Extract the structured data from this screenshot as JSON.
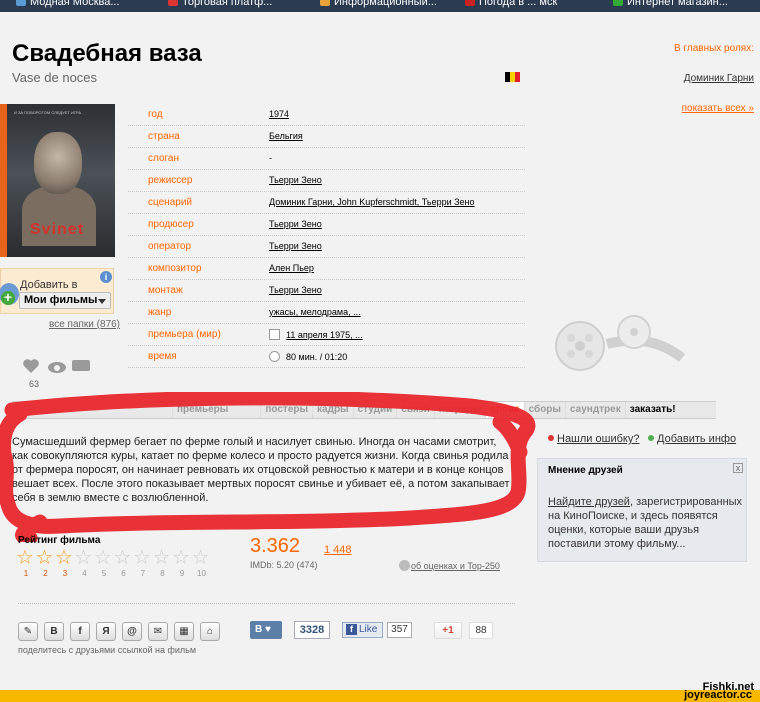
{
  "bookmarks": [
    {
      "label": "Модная Москва..."
    },
    {
      "label": "Торговая платф..."
    },
    {
      "label": "Информационный..."
    },
    {
      "label": "Погода в ... мск"
    },
    {
      "label": "Интернет магазин..."
    }
  ],
  "film": {
    "title": "Свадебная ваза",
    "original_title": "Vase de noces"
  },
  "roles": {
    "heading": "В главных ролях:",
    "actor": "Доминик Гарни",
    "show_all": "показать всех »"
  },
  "poster": {
    "title": "Svinet",
    "top_text": "И ЗА ПОВОРОТОМ СЛЕДУЕТ ИГРА"
  },
  "add_box": {
    "label": "Добавить в",
    "selected": "Мои фильмы",
    "info_icon": "i",
    "all_folders": "все папки (876)"
  },
  "stats": {
    "count": "63"
  },
  "info_rows": [
    {
      "key": "год",
      "value": "1974"
    },
    {
      "key": "страна",
      "value": "Бельгия"
    },
    {
      "key": "слоган",
      "value": "-"
    },
    {
      "key": "режиссер",
      "value": "Тьерри Зено"
    },
    {
      "key": "сценарий",
      "value": "Доминик Гарни, John Kupferschmidt, Тьерри Зено"
    },
    {
      "key": "продюсер",
      "value": "Тьерри Зено"
    },
    {
      "key": "оператор",
      "value": "Тьерри Зено"
    },
    {
      "key": "композитор",
      "value": "Ален Пьер"
    },
    {
      "key": "монтаж",
      "value": "Тьерри Зено"
    },
    {
      "key": "жанр",
      "value": "ужасы, мелодрама, ..."
    },
    {
      "key": "премьера (мир)",
      "value": "11 апреля 1975, ..."
    },
    {
      "key": "время",
      "value": "80 мин. / 01:20"
    }
  ],
  "tabs": [
    "",
    "",
    "премьеры",
    "",
    "постеры",
    "кадры",
    "студии",
    "связи",
    "награды",
    "слова",
    "сборы",
    "саундтрек",
    "заказать!"
  ],
  "tagline": "Сумасшедший фермер бегает по ферме голый и насилует свинью. Иногда он часами смотрит, как совокупляются куры, катает по ферме колесо и просто радуется жизни. Когда свинья родила от фермера поросят, он начинает ревновать их отцовской ревностью к матери и в конце концов вешает всех. После этого показывает мертвых поросят свинье и убивает её, а потом закапывает себя в землю вместе с возлюбленной.",
  "side_links": {
    "error": "Нашли ошибку?",
    "add_info": "Добавить инфо"
  },
  "friends": {
    "heading": "Мнение друзей",
    "close": "x",
    "link": "Найдите друзей",
    "text": ", зарегистрированных на КиноПоиске, и здесь появятся оценки, которые ваши друзья поставили этому фильму..."
  },
  "rating": {
    "heading": "Рейтинг фильма",
    "user_rating": 3,
    "max": 10,
    "numbers": [
      "1",
      "2",
      "3",
      "4",
      "5",
      "6",
      "7",
      "8",
      "9",
      "10"
    ],
    "score": "3.362",
    "votes": "1 448",
    "imdb": "IMDb: 5.20 (474)",
    "about": "об оценках и Top-250"
  },
  "share": {
    "buttons": [
      "✎",
      "B",
      "f",
      "Я",
      "@",
      "✉",
      "▦",
      "⌂"
    ],
    "note": "поделитесь с друзьями ссылкой на фильм",
    "vk_label": "В ♥",
    "vk_count": "3328",
    "fb_label": "Like",
    "fb_count": "357",
    "gplus_label": "+1",
    "gplus_count": "88"
  },
  "watermarks": {
    "top": "Fishki.net",
    "bottom": "joyreactor.cc"
  },
  "colors": {
    "accent": "#ff6600",
    "scribble": "#e8242a",
    "bottom_bar": "#f8b800"
  }
}
